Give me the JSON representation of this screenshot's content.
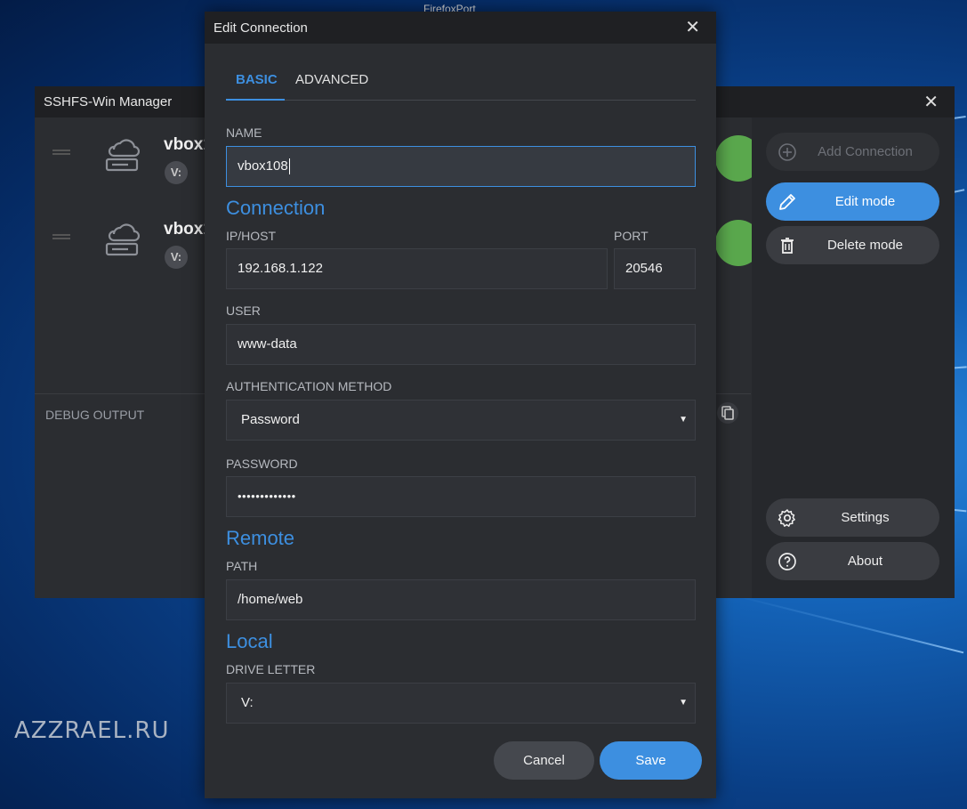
{
  "desktop": {
    "top_window_title": "FirefoxPort",
    "watermark": "AZZRAEL.RU"
  },
  "manager": {
    "title": "SSHFS-Win Manager",
    "connections": [
      {
        "name": "vbox1",
        "drive": "V:"
      },
      {
        "name": "vbox1",
        "drive": "V:"
      }
    ],
    "debug_label": "DEBUG OUTPUT",
    "sidebar": {
      "add_connection": "Add Connection",
      "edit_mode": "Edit mode",
      "delete_mode": "Delete mode",
      "settings": "Settings",
      "about": "About"
    },
    "status_color": "#5aa84d",
    "accent": "#3d8fe0"
  },
  "dialog": {
    "title": "Edit Connection",
    "tabs": [
      "BASIC",
      "ADVANCED"
    ],
    "active_tab": "BASIC",
    "name_label": "NAME",
    "name_value": "vbox108",
    "connection_heading": "Connection",
    "host_label": "IP/HOST",
    "host_value": "192.168.1.122",
    "port_label": "PORT",
    "port_value": "20546",
    "user_label": "USER",
    "user_value": "www-data",
    "auth_label": "AUTHENTICATION METHOD",
    "auth_value": "Password",
    "password_label": "PASSWORD",
    "password_value": "•••••••••••••",
    "remote_heading": "Remote",
    "path_label": "PATH",
    "path_value": "/home/web",
    "local_heading": "Local",
    "drive_label": "DRIVE LETTER",
    "drive_value": "V:",
    "cancel": "Cancel",
    "save": "Save"
  }
}
